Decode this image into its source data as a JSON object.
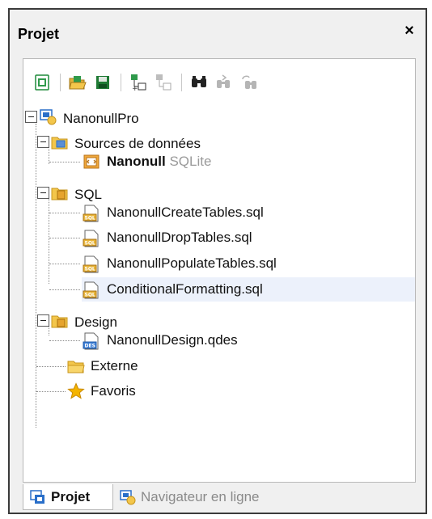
{
  "panel": {
    "title": "Projet",
    "close_label": "×"
  },
  "toolbar": {
    "buttons": [
      "new-project-icon",
      "open-project-icon",
      "save-project-icon",
      "add-datasource-icon",
      "remove-datasource-icon",
      "find-icon",
      "find-next-icon",
      "find-in-files-icon"
    ]
  },
  "tree": {
    "root": "NanonullPro",
    "sources": {
      "label": "Sources de données",
      "item_name": "Nanonull",
      "item_type": "SQLite"
    },
    "sql": {
      "label": "SQL",
      "files": [
        "NanonullCreateTables.sql",
        "NanonullDropTables.sql",
        "NanonullPopulateTables.sql",
        "ConditionalFormatting.sql"
      ]
    },
    "design": {
      "label": "Design",
      "files": [
        "NanonullDesign.qdes"
      ]
    },
    "externe": "Externe",
    "favoris": "Favoris"
  },
  "tabs": {
    "projet": "Projet",
    "navigateur": "Navigateur en ligne"
  },
  "colors": {
    "folder": "#f3c64b",
    "folder_dark": "#c7951d",
    "blue": "#2a6fc9",
    "green": "#1e8a3a",
    "star": "#f4b400",
    "selection": "#ecf1fb"
  }
}
